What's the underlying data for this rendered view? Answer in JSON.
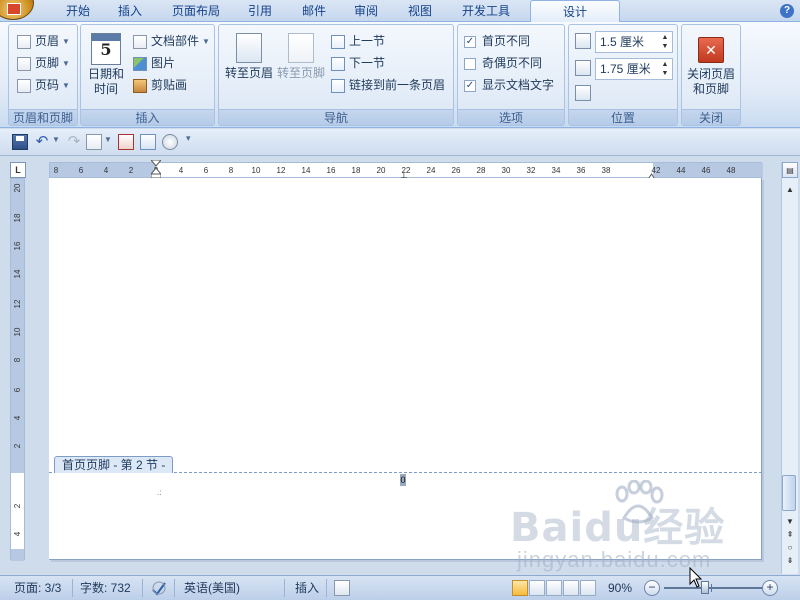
{
  "tabs": [
    "开始",
    "插入",
    "页面布局",
    "引用",
    "邮件",
    "审阅",
    "视图",
    "开发工具",
    "设计"
  ],
  "active_tab": "设计",
  "ribbon": {
    "header_footer": {
      "label": "页眉和页脚",
      "header": "页眉",
      "footer": "页脚",
      "page_number": "页码"
    },
    "insert": {
      "label": "插入",
      "date_time": "日期和时间",
      "calendar_day": "5",
      "quick_parts": "文档部件",
      "picture": "图片",
      "clip_art": "剪贴画"
    },
    "navigation": {
      "label": "导航",
      "go_to_header": "转至页眉",
      "go_to_footer": "转至页脚",
      "previous_section": "上一节",
      "next_section": "下一节",
      "link_to_previous": "链接到前一条页眉"
    },
    "options": {
      "label": "选项",
      "different_first_page": "首页不同",
      "different_odd_even": "奇偶页不同",
      "show_document_text": "显示文档文字"
    },
    "position": {
      "label": "位置",
      "header_from_top": "1.5 厘米",
      "footer_from_bottom": "1.75 厘米"
    },
    "close": {
      "label": "关闭",
      "close_header_footer": "关闭页眉和页脚",
      "close_icon": "close-x-icon"
    }
  },
  "ruler": {
    "horizontal_ticks": [
      "8",
      "6",
      "4",
      "2",
      "2",
      "4",
      "6",
      "8",
      "10",
      "12",
      "14",
      "16",
      "18",
      "20",
      "22",
      "24",
      "26",
      "28",
      "30",
      "32",
      "34",
      "36",
      "38",
      "42",
      "44",
      "46",
      "48"
    ],
    "vertical_ticks": [
      "20",
      "18",
      "16",
      "14",
      "12",
      "10",
      "8",
      "6",
      "4",
      "2",
      "2",
      "4"
    ],
    "corner": "L"
  },
  "document": {
    "footer_tag": "首页页脚 - 第 2 节 -",
    "footer_field": "0",
    "paragraph_mark": ".:"
  },
  "statusbar": {
    "page": "页面: 3/3",
    "words": "字数: 732",
    "language": "英语(美国)",
    "insert_mode": "插入",
    "zoom": "90%",
    "zoom_level_percent": 90
  },
  "watermark": {
    "text": "Baidu经验",
    "url": "jingyan.baidu.com"
  }
}
